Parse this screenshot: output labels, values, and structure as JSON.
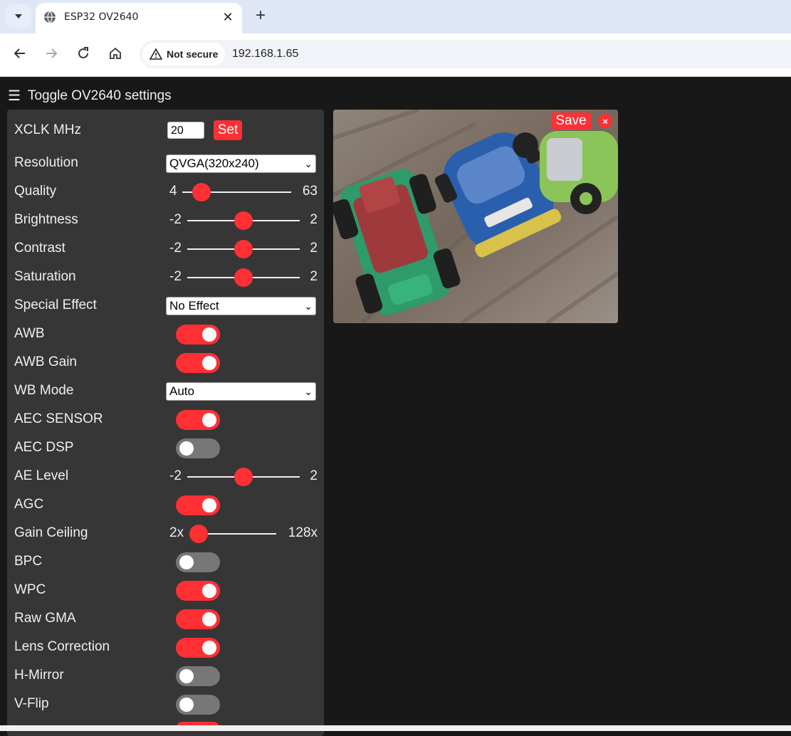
{
  "browser": {
    "tab_title": "ESP32 OV2640",
    "security_label": "Not secure",
    "url": "192.168.1.65"
  },
  "page": {
    "toggle_label": "Toggle OV2640 settings",
    "xclk": {
      "label": "XCLK MHz",
      "value": "20",
      "button": "Set"
    },
    "resolution": {
      "label": "Resolution",
      "value": "QVGA(320x240)"
    },
    "quality": {
      "label": "Quality",
      "min": "4",
      "max": "63",
      "value": 10
    },
    "brightness": {
      "label": "Brightness",
      "min": "-2",
      "max": "2",
      "value": 0
    },
    "contrast": {
      "label": "Contrast",
      "min": "-2",
      "max": "2",
      "value": 0
    },
    "saturation": {
      "label": "Saturation",
      "min": "-2",
      "max": "2",
      "value": 0
    },
    "special_effect": {
      "label": "Special Effect",
      "value": "No Effect"
    },
    "awb": {
      "label": "AWB",
      "on": true
    },
    "awb_gain": {
      "label": "AWB Gain",
      "on": true
    },
    "wb_mode": {
      "label": "WB Mode",
      "value": "Auto"
    },
    "aec_sensor": {
      "label": "AEC SENSOR",
      "on": true
    },
    "aec_dsp": {
      "label": "AEC DSP",
      "on": false
    },
    "ae_level": {
      "label": "AE Level",
      "min": "-2",
      "max": "2",
      "value": 0
    },
    "agc": {
      "label": "AGC",
      "on": true
    },
    "gain_ceiling": {
      "label": "Gain Ceiling",
      "min": "2x",
      "max": "128x",
      "value": 0
    },
    "bpc": {
      "label": "BPC",
      "on": false
    },
    "wpc": {
      "label": "WPC",
      "on": true
    },
    "raw_gma": {
      "label": "Raw GMA",
      "on": true
    },
    "lenc": {
      "label": "Lens Correction",
      "on": true
    },
    "hmirror": {
      "label": "H-Mirror",
      "on": false
    },
    "vflip": {
      "label": "V-Flip",
      "on": false
    },
    "image": {
      "save_label": "Save",
      "close_label": "×"
    }
  },
  "colors": {
    "accent": "#ff3034",
    "panel": "#363636",
    "background": "#181818"
  }
}
